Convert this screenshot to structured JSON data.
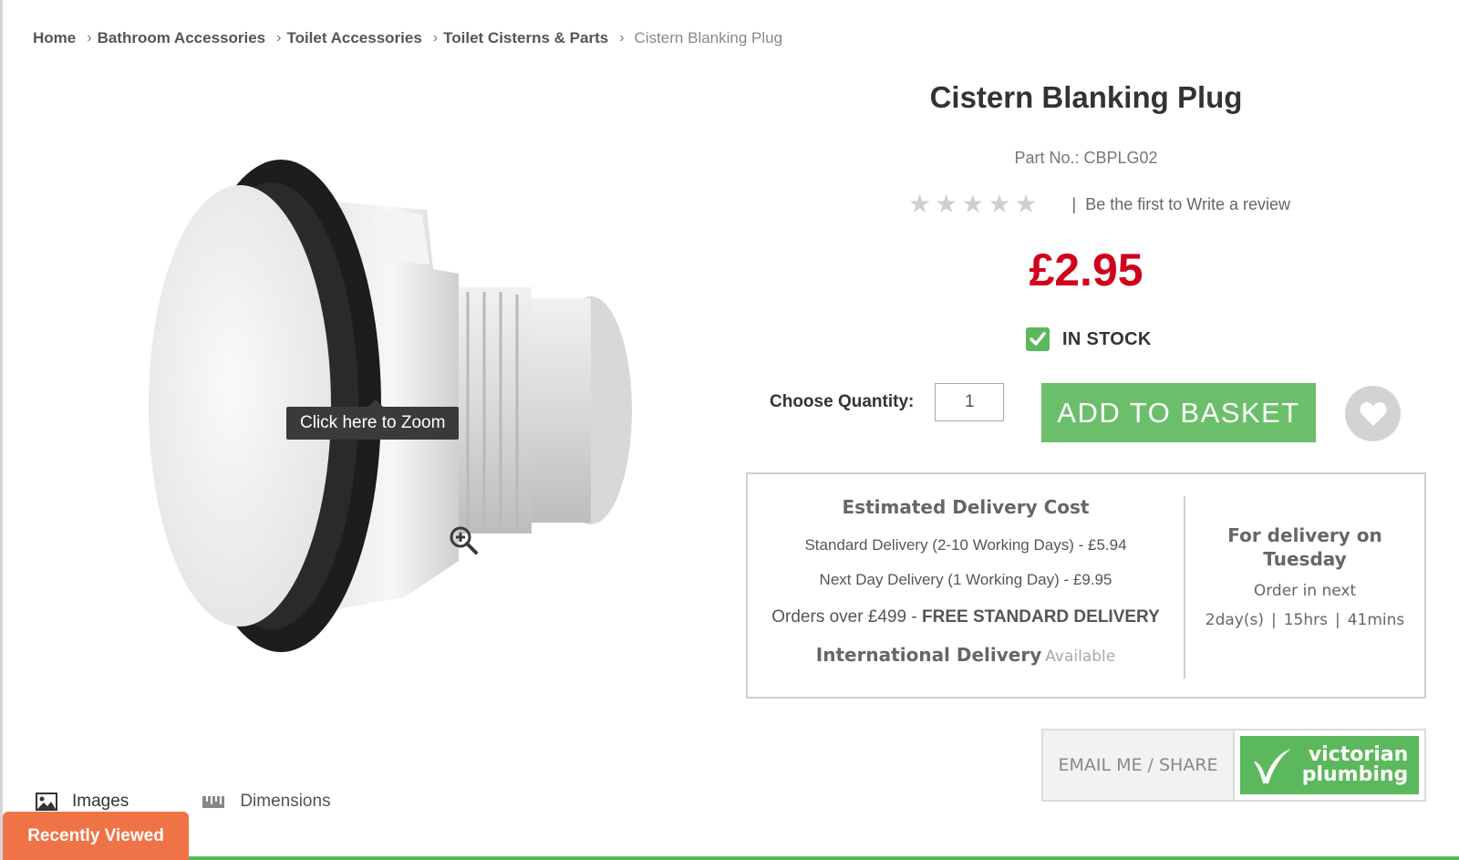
{
  "breadcrumb": {
    "items": [
      "Home",
      "Bathroom Accessories",
      "Toilet Accessories",
      "Toilet Cisterns & Parts"
    ],
    "current": "Cistern Blanking Plug",
    "separator": "›"
  },
  "product": {
    "title": "Cistern Blanking Plug",
    "part_no": "Part No.: CBPLG02",
    "rating": {
      "stars": 0,
      "max": 5
    },
    "review_link": "Be the first to Write a review",
    "price": "£2.95",
    "stock": "IN STOCK"
  },
  "image": {
    "zoom_tooltip": "Click here to Zoom",
    "tabs": [
      {
        "label": "Images",
        "icon": "image-icon"
      },
      {
        "label": "Dimensions",
        "icon": "ruler-icon"
      }
    ]
  },
  "purchase": {
    "quantity_label": "Choose Quantity:",
    "quantity_value": "1",
    "add_to_basket": "ADD TO BASKET"
  },
  "delivery": {
    "title": "Estimated Delivery Cost",
    "standard": "Standard Delivery (2-10 Working Days) - £5.94",
    "next_day": "Next Day Delivery (1 Working Day) - £9.95",
    "free_prefix": "Orders over £499 - ",
    "free_bold": "FREE STANDARD DELIVERY",
    "international_label": "International Delivery",
    "international_status": "Available",
    "for_delivery_on": "For delivery on Tuesday",
    "order_in_next": "Order in next",
    "countdown": {
      "days": "2day(s)",
      "hours": "15hrs",
      "mins": "41mins"
    }
  },
  "share": {
    "email_label": "EMAIL ME / SHARE",
    "logo_line1": "victorian",
    "logo_line2": "plumbing"
  },
  "recently_viewed": "Recently Viewed",
  "colors": {
    "price": "#d0021b",
    "accent_green": "#6cbf6a",
    "recent_orange": "#f07348"
  }
}
